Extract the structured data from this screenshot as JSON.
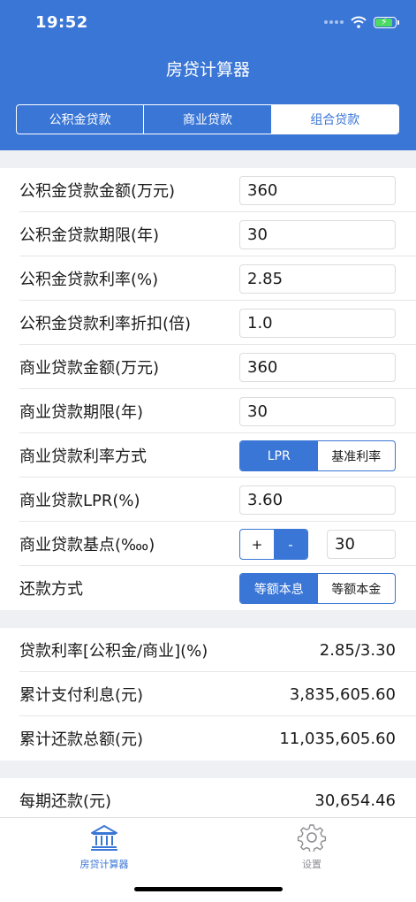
{
  "status": {
    "time": "19:52"
  },
  "header": {
    "title": "房贷计算器"
  },
  "segments": [
    {
      "label": "公积金贷款"
    },
    {
      "label": "商业贷款"
    },
    {
      "label": "组合贷款"
    }
  ],
  "form": {
    "fund_amount": {
      "label": "公积金贷款金额(万元)",
      "value": "360"
    },
    "fund_years": {
      "label": "公积金贷款期限(年)",
      "value": "30"
    },
    "fund_rate": {
      "label": "公积金贷款利率(%)",
      "value": "2.85"
    },
    "fund_discount": {
      "label": "公积金贷款利率折扣(倍)",
      "value": "1.0"
    },
    "biz_amount": {
      "label": "商业贷款金额(万元)",
      "value": "360"
    },
    "biz_years": {
      "label": "商业贷款期限(年)",
      "value": "30"
    },
    "biz_rate_mode": {
      "label": "商业贷款利率方式",
      "options": [
        "LPR",
        "基准利率"
      ]
    },
    "biz_lpr": {
      "label": "商业贷款LPR(%)",
      "value": "3.60"
    },
    "biz_basis": {
      "label": "商业贷款基点(‱)",
      "plus": "+",
      "minus": "-",
      "value": "30"
    },
    "repay_mode": {
      "label": "还款方式",
      "options": [
        "等额本息",
        "等额本金"
      ]
    }
  },
  "results": {
    "rate": {
      "label": "贷款利率[公积金/商业](%)",
      "value": "2.85/3.30"
    },
    "interest": {
      "label": "累计支付利息(元)",
      "value": "3,835,605.60"
    },
    "total": {
      "label": "累计还款总额(元)",
      "value": "11,035,605.60"
    },
    "monthly": {
      "label": "每期还款(元)",
      "value": "30,654.46"
    }
  },
  "tabbar": {
    "calc": {
      "label": "房贷计算器",
      "icon": "bank-icon"
    },
    "settings": {
      "label": "设置",
      "icon": "gear-icon"
    }
  },
  "colors": {
    "accent": "#3a76d6",
    "background": "#eff0f3"
  }
}
